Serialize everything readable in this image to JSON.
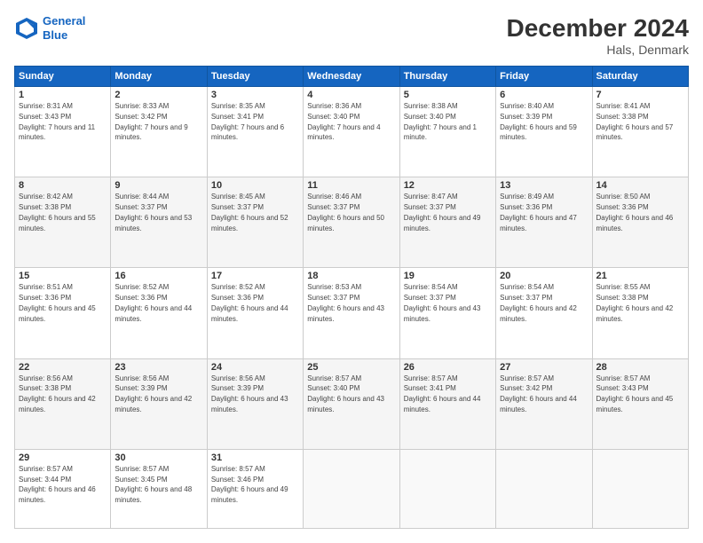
{
  "header": {
    "logo_line1": "General",
    "logo_line2": "Blue",
    "title": "December 2024",
    "subtitle": "Hals, Denmark"
  },
  "weekdays": [
    "Sunday",
    "Monday",
    "Tuesday",
    "Wednesday",
    "Thursday",
    "Friday",
    "Saturday"
  ],
  "weeks": [
    [
      {
        "day": "1",
        "rise": "Sunrise: 8:31 AM",
        "set": "Sunset: 3:43 PM",
        "daylight": "Daylight: 7 hours and 11 minutes."
      },
      {
        "day": "2",
        "rise": "Sunrise: 8:33 AM",
        "set": "Sunset: 3:42 PM",
        "daylight": "Daylight: 7 hours and 9 minutes."
      },
      {
        "day": "3",
        "rise": "Sunrise: 8:35 AM",
        "set": "Sunset: 3:41 PM",
        "daylight": "Daylight: 7 hours and 6 minutes."
      },
      {
        "day": "4",
        "rise": "Sunrise: 8:36 AM",
        "set": "Sunset: 3:40 PM",
        "daylight": "Daylight: 7 hours and 4 minutes."
      },
      {
        "day": "5",
        "rise": "Sunrise: 8:38 AM",
        "set": "Sunset: 3:40 PM",
        "daylight": "Daylight: 7 hours and 1 minute."
      },
      {
        "day": "6",
        "rise": "Sunrise: 8:40 AM",
        "set": "Sunset: 3:39 PM",
        "daylight": "Daylight: 6 hours and 59 minutes."
      },
      {
        "day": "7",
        "rise": "Sunrise: 8:41 AM",
        "set": "Sunset: 3:38 PM",
        "daylight": "Daylight: 6 hours and 57 minutes."
      }
    ],
    [
      {
        "day": "8",
        "rise": "Sunrise: 8:42 AM",
        "set": "Sunset: 3:38 PM",
        "daylight": "Daylight: 6 hours and 55 minutes."
      },
      {
        "day": "9",
        "rise": "Sunrise: 8:44 AM",
        "set": "Sunset: 3:37 PM",
        "daylight": "Daylight: 6 hours and 53 minutes."
      },
      {
        "day": "10",
        "rise": "Sunrise: 8:45 AM",
        "set": "Sunset: 3:37 PM",
        "daylight": "Daylight: 6 hours and 52 minutes."
      },
      {
        "day": "11",
        "rise": "Sunrise: 8:46 AM",
        "set": "Sunset: 3:37 PM",
        "daylight": "Daylight: 6 hours and 50 minutes."
      },
      {
        "day": "12",
        "rise": "Sunrise: 8:47 AM",
        "set": "Sunset: 3:37 PM",
        "daylight": "Daylight: 6 hours and 49 minutes."
      },
      {
        "day": "13",
        "rise": "Sunrise: 8:49 AM",
        "set": "Sunset: 3:36 PM",
        "daylight": "Daylight: 6 hours and 47 minutes."
      },
      {
        "day": "14",
        "rise": "Sunrise: 8:50 AM",
        "set": "Sunset: 3:36 PM",
        "daylight": "Daylight: 6 hours and 46 minutes."
      }
    ],
    [
      {
        "day": "15",
        "rise": "Sunrise: 8:51 AM",
        "set": "Sunset: 3:36 PM",
        "daylight": "Daylight: 6 hours and 45 minutes."
      },
      {
        "day": "16",
        "rise": "Sunrise: 8:52 AM",
        "set": "Sunset: 3:36 PM",
        "daylight": "Daylight: 6 hours and 44 minutes."
      },
      {
        "day": "17",
        "rise": "Sunrise: 8:52 AM",
        "set": "Sunset: 3:36 PM",
        "daylight": "Daylight: 6 hours and 44 minutes."
      },
      {
        "day": "18",
        "rise": "Sunrise: 8:53 AM",
        "set": "Sunset: 3:37 PM",
        "daylight": "Daylight: 6 hours and 43 minutes."
      },
      {
        "day": "19",
        "rise": "Sunrise: 8:54 AM",
        "set": "Sunset: 3:37 PM",
        "daylight": "Daylight: 6 hours and 43 minutes."
      },
      {
        "day": "20",
        "rise": "Sunrise: 8:54 AM",
        "set": "Sunset: 3:37 PM",
        "daylight": "Daylight: 6 hours and 42 minutes."
      },
      {
        "day": "21",
        "rise": "Sunrise: 8:55 AM",
        "set": "Sunset: 3:38 PM",
        "daylight": "Daylight: 6 hours and 42 minutes."
      }
    ],
    [
      {
        "day": "22",
        "rise": "Sunrise: 8:56 AM",
        "set": "Sunset: 3:38 PM",
        "daylight": "Daylight: 6 hours and 42 minutes."
      },
      {
        "day": "23",
        "rise": "Sunrise: 8:56 AM",
        "set": "Sunset: 3:39 PM",
        "daylight": "Daylight: 6 hours and 42 minutes."
      },
      {
        "day": "24",
        "rise": "Sunrise: 8:56 AM",
        "set": "Sunset: 3:39 PM",
        "daylight": "Daylight: 6 hours and 43 minutes."
      },
      {
        "day": "25",
        "rise": "Sunrise: 8:57 AM",
        "set": "Sunset: 3:40 PM",
        "daylight": "Daylight: 6 hours and 43 minutes."
      },
      {
        "day": "26",
        "rise": "Sunrise: 8:57 AM",
        "set": "Sunset: 3:41 PM",
        "daylight": "Daylight: 6 hours and 44 minutes."
      },
      {
        "day": "27",
        "rise": "Sunrise: 8:57 AM",
        "set": "Sunset: 3:42 PM",
        "daylight": "Daylight: 6 hours and 44 minutes."
      },
      {
        "day": "28",
        "rise": "Sunrise: 8:57 AM",
        "set": "Sunset: 3:43 PM",
        "daylight": "Daylight: 6 hours and 45 minutes."
      }
    ],
    [
      {
        "day": "29",
        "rise": "Sunrise: 8:57 AM",
        "set": "Sunset: 3:44 PM",
        "daylight": "Daylight: 6 hours and 46 minutes."
      },
      {
        "day": "30",
        "rise": "Sunrise: 8:57 AM",
        "set": "Sunset: 3:45 PM",
        "daylight": "Daylight: 6 hours and 48 minutes."
      },
      {
        "day": "31",
        "rise": "Sunrise: 8:57 AM",
        "set": "Sunset: 3:46 PM",
        "daylight": "Daylight: 6 hours and 49 minutes."
      },
      null,
      null,
      null,
      null
    ]
  ]
}
